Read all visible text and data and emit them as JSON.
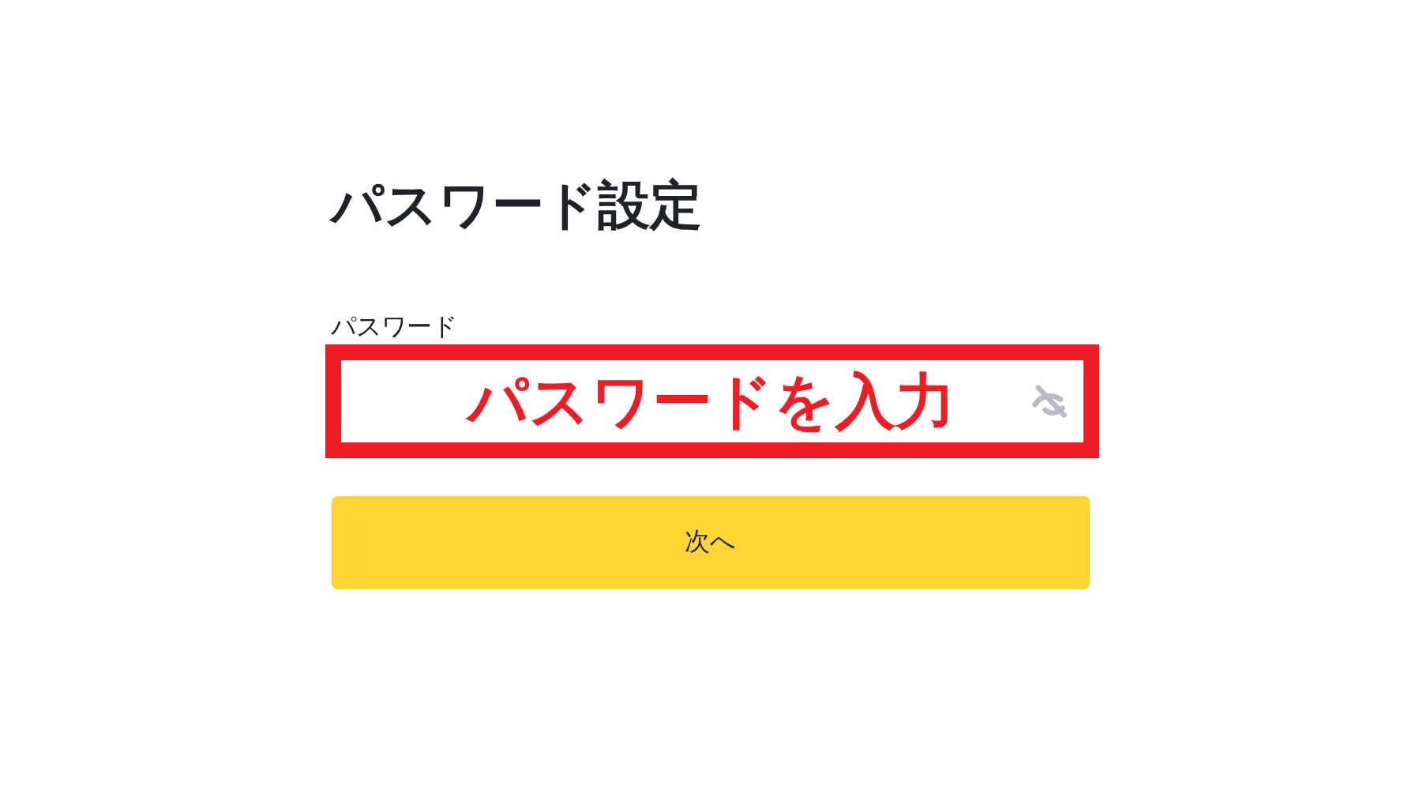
{
  "title": "パスワード設定",
  "password_field": {
    "label": "パスワード",
    "annotation": "パスワードを入力",
    "highlighted": true
  },
  "next_button": {
    "label": "次へ"
  }
}
